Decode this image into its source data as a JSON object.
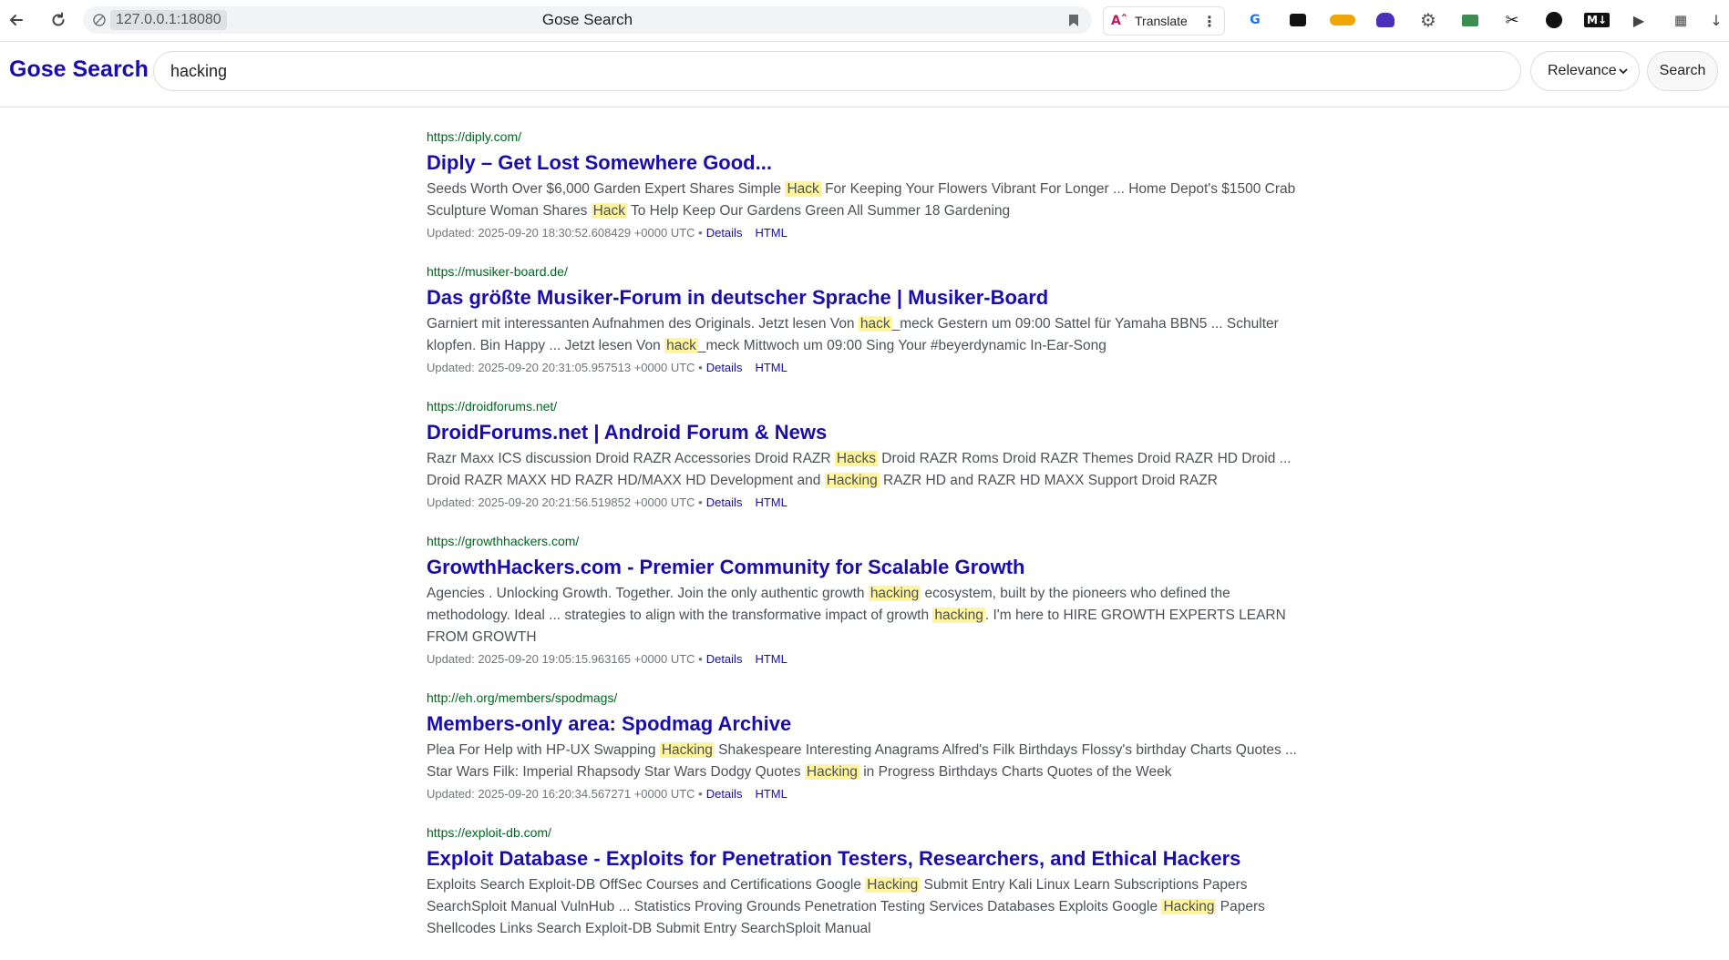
{
  "browser": {
    "url": "127.0.0.1:18080",
    "tab_title": "Gose Search",
    "translate_label": "Translate",
    "extensions": [
      "translate-ext-icon",
      "extension-icon",
      "ex-gen-icon",
      "extension-icon",
      "gear-icon",
      "extension-icon",
      "scissors-icon",
      "extension-icon",
      "markdown-icon",
      "play-icon",
      "extension-icon",
      "download-icon"
    ]
  },
  "header": {
    "brand": "Gose Search",
    "query": "hacking",
    "sort_value": "Relevance",
    "search_label": "Search"
  },
  "results": [
    {
      "url": "https://diply.com/",
      "title": "Diply – Get Lost Somewhere Good...",
      "snippet": [
        {
          "t": "Seeds Worth Over $6,000 Garden Expert Shares Simple "
        },
        {
          "h": "Hack"
        },
        {
          "t": " For Keeping Your Flowers Vibrant For Longer ... Home Depot's $1500 Crab Sculpture Woman Shares "
        },
        {
          "h": "Hack"
        },
        {
          "t": " To Help Keep Our Gardens Green All Summer 18 Gardening"
        }
      ],
      "updated": "Updated: 2025-09-20 18:30:52.608429 +0000 UTC •",
      "details": "Details",
      "html": "HTML"
    },
    {
      "url": "https://musiker-board.de/",
      "title": "Das größte Musiker-Forum in deutscher Sprache | Musiker-Board",
      "snippet": [
        {
          "t": "Garniert mit interessanten Aufnahmen des Originals. Jetzt lesen Von "
        },
        {
          "h": "hack"
        },
        {
          "t": "_meck Gestern um 09:00   Sattel für Yamaha BBN5 ... Schulter klopfen. Bin Happy ... Jetzt lesen Von "
        },
        {
          "h": "hack"
        },
        {
          "t": "_meck Mittwoch um 09:00   Sing Your #beyerdynamic In-Ear-Song"
        }
      ],
      "updated": "Updated: 2025-09-20 20:31:05.957513 +0000 UTC •",
      "details": "Details",
      "html": "HTML"
    },
    {
      "url": "https://droidforums.net/",
      "title": "DroidForums.net | Android Forum & News",
      "snippet": [
        {
          "t": "Razr Maxx ICS discussion Droid RAZR Accessories Droid RAZR "
        },
        {
          "h": "Hacks"
        },
        {
          "t": " Droid RAZR Roms Droid RAZR Themes Droid RAZR HD Droid ... Droid RAZR MAXX HD RAZR HD/MAXX HD Development and "
        },
        {
          "h": "Hacking"
        },
        {
          "t": " RAZR HD and RAZR HD MAXX Support Droid RAZR"
        }
      ],
      "updated": "Updated: 2025-09-20 20:21:56.519852 +0000 UTC •",
      "details": "Details",
      "html": "HTML"
    },
    {
      "url": "https://growthhackers.com/",
      "title": "GrowthHackers.com - Premier Community for Scalable Growth",
      "snippet": [
        {
          "t": "Agencies . Unlocking Growth. Together. Join the only authentic growth "
        },
        {
          "h": "hacking"
        },
        {
          "t": " ecosystem, built by the pioneers who defined the methodology. Ideal ... strategies to align with the transformative impact of growth "
        },
        {
          "h": "hacking"
        },
        {
          "t": ". I'm here to HIRE GROWTH EXPERTS LEARN FROM GROWTH"
        }
      ],
      "updated": "Updated: 2025-09-20 19:05:15.963165 +0000 UTC •",
      "details": "Details",
      "html": "HTML"
    },
    {
      "url": "http://eh.org/members/spodmags/",
      "title": "Members-only area: Spodmag Archive",
      "snippet": [
        {
          "t": "Plea For Help with HP-UX Swapping "
        },
        {
          "h": "Hacking"
        },
        {
          "t": " Shakespeare Interesting Anagrams Alfred's Filk Birthdays Flossy's birthday Charts Quotes ... Star Wars Filk: Imperial Rhapsody Star Wars Dodgy Quotes "
        },
        {
          "h": "Hacking"
        },
        {
          "t": " in Progress Birthdays Charts Quotes of the Week"
        }
      ],
      "updated": "Updated: 2025-09-20 16:20:34.567271 +0000 UTC •",
      "details": "Details",
      "html": "HTML"
    },
    {
      "url": "https://exploit-db.com/",
      "title": "Exploit Database - Exploits for Penetration Testers, Researchers, and Ethical Hackers",
      "snippet": [
        {
          "t": "Exploits Search Exploit-DB OffSec Courses and Certifications Google "
        },
        {
          "h": "Hacking"
        },
        {
          "t": " Submit Entry Kali Linux Learn Subscriptions Papers SearchSploit Manual VulnHub ... Statistics Proving Grounds Penetration Testing Services Databases Exploits Google "
        },
        {
          "h": "Hacking"
        },
        {
          "t": " Papers Shellcodes Links Search Exploit-DB Submit Entry SearchSploit Manual"
        }
      ],
      "updated": "",
      "details": "",
      "html": ""
    }
  ]
}
